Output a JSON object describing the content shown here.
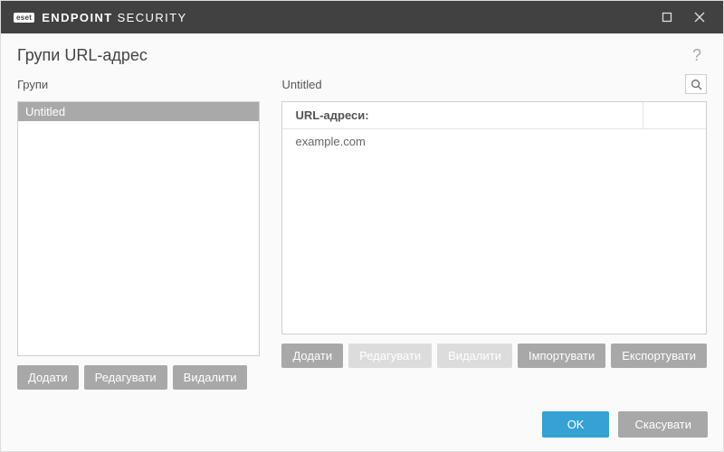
{
  "titlebar": {
    "brand_badge": "eset",
    "brand_bold": "ENDPOINT",
    "brand_rest": " SECURITY"
  },
  "page_title": "Групи URL-адрес",
  "help_tooltip": "?",
  "left": {
    "label": "Групи",
    "items": [
      "Untitled"
    ],
    "buttons": {
      "add": "Додати",
      "edit": "Редагувати",
      "delete": "Видалити"
    }
  },
  "right": {
    "label": "Untitled",
    "table_header": "URL-адреси:",
    "rows": [
      "example.com"
    ],
    "buttons": {
      "add": "Додати",
      "edit": "Редагувати",
      "delete": "Видалити",
      "import": "Імпортувати",
      "export": "Експортувати"
    }
  },
  "footer": {
    "ok": "OK",
    "cancel": "Скасувати"
  }
}
